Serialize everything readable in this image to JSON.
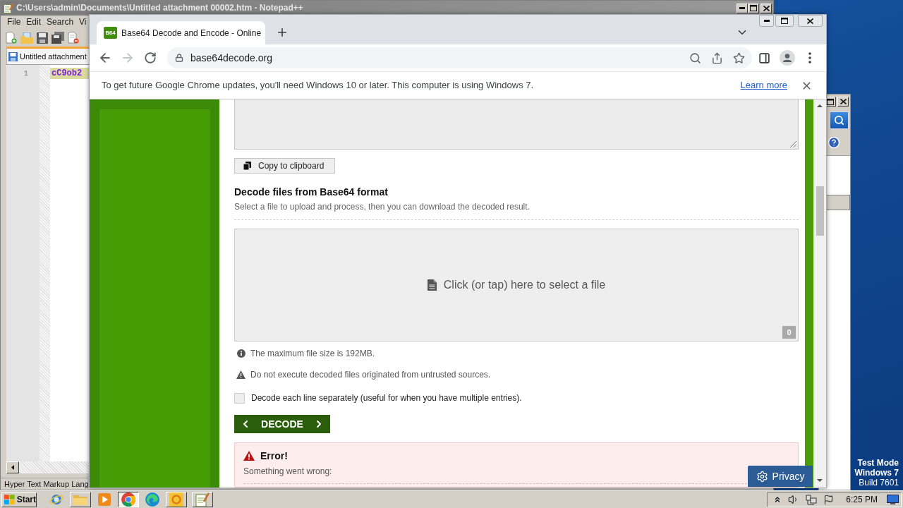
{
  "notepad": {
    "title": "C:\\Users\\admin\\Documents\\Untitled attachment 00002.htm - Notepad++",
    "menu": [
      "File",
      "Edit",
      "Search",
      "Vi"
    ],
    "tab": "Untitled attachment",
    "line_number": "1",
    "code": "cC9ob2",
    "status": "Hyper Text Markup Lang"
  },
  "browser": {
    "tabs": [
      {
        "favicon": "B64",
        "title": "Base64 Decode and Encode - Online",
        "selected": true
      }
    ],
    "nav": [
      {
        "kind": "back",
        "disabled": false
      },
      {
        "kind": "forward",
        "disabled": true
      },
      {
        "kind": "reload",
        "disabled": false
      }
    ],
    "url": "base64decode.org",
    "infobar": {
      "message": "To get future Google Chrome updates, you'll need Windows 10 or later. This computer is using Windows 7.",
      "link": "Learn more"
    }
  },
  "page": {
    "copy_button": "Copy to clipboard",
    "heading": "Decode files from Base64 format",
    "subtitle": "Select a file to upload and process, then you can download the decoded result.",
    "dropzone": {
      "label": "Click (or tap) here to select a file",
      "count": "0"
    },
    "notes": [
      {
        "kind": "info",
        "text": "The maximum file size is 192MB."
      },
      {
        "kind": "warning",
        "text": "Do not execute decoded files originated from untrusted sources."
      }
    ],
    "option": {
      "label": "Decode each line separately (useful for when you have multiple entries).",
      "checked": false
    },
    "decode_button": "DECODE",
    "error": {
      "title": "Error!",
      "message": "Something went wrong:"
    },
    "privacy_button": "Privacy"
  },
  "desktop": {
    "notice": [
      "Test Mode",
      "Windows 7",
      "Build 7601"
    ]
  },
  "taskbar": {
    "start": "Start",
    "apps": [
      {
        "kind": "orbit",
        "open": false,
        "selected": false
      },
      {
        "kind": "folder",
        "open": true,
        "selected": false
      },
      {
        "kind": "player",
        "open": false,
        "selected": false
      },
      {
        "kind": "chrome",
        "open": true,
        "selected": true
      },
      {
        "kind": "edge",
        "open": false,
        "selected": false
      },
      {
        "kind": "ring",
        "open": true,
        "selected": false
      },
      {
        "kind": "notepad",
        "open": true,
        "selected": false
      }
    ],
    "clock": "6:25 PM"
  }
}
